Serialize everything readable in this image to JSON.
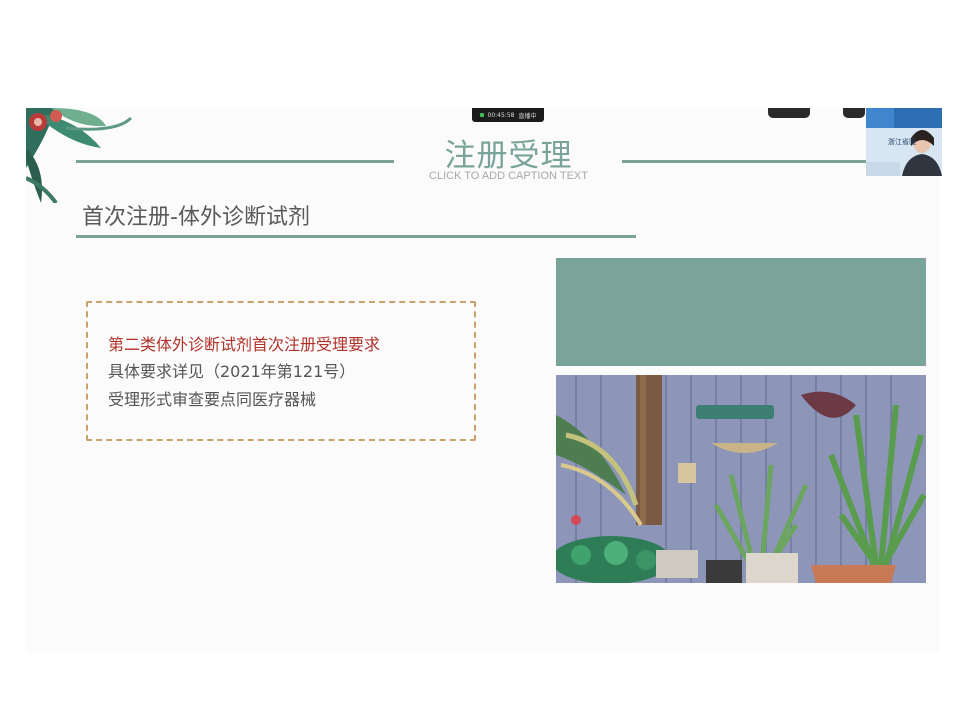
{
  "slide": {
    "title": "注册受理",
    "caption": "CLICK TO ADD CAPTION TEXT",
    "section_title": "首次注册-体外诊断试剂",
    "box_lines": {
      "line1": "第二类体外诊断试剂首次注册受理要求",
      "line2": "具体要求详见（2021年第121号）",
      "line3": "受理形式审查要点同医疗器械"
    }
  },
  "meeting": {
    "timer": "00:45:58",
    "status": "直播中",
    "participant_label": "浙江省医"
  },
  "colors": {
    "accent": "#7aa39a",
    "highlight_text": "#b1322a",
    "dash_border": "#c9a26a"
  },
  "icons": [
    "leaf-decoration-icon",
    "recording-icon"
  ]
}
